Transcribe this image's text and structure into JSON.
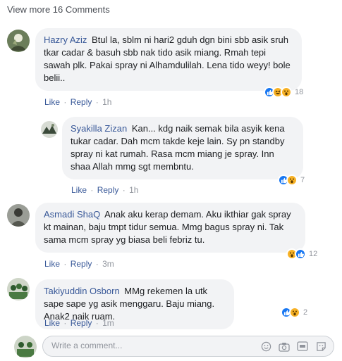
{
  "view_more": "View more 16 Comments",
  "actions": {
    "like": "Like",
    "reply": "Reply",
    "separator": "·"
  },
  "comments": [
    {
      "author": "Hazry Aziz",
      "text": "Btul la, sblm ni hari2 gduh dgn bini sbb asik sruh tkar cadar & basuh sbb nak tido asik miang. Rmah tepi sawah plk. Pakai spray ni Alhamdulilah. Lena tido weyy! bole belii..",
      "time": "1h",
      "reaction_count": "18",
      "reactions": [
        "like-icon",
        "haha-icon",
        "wow-icon"
      ]
    },
    {
      "author": "Syakilla Zizan",
      "text": "Kan... kdg naik semak bila asyik kena tukar cadar. Dah mcm takde keje lain. Sy pn standby spray ni kat rumah. Rasa mcm miang je spray. Inn shaa Allah mmg sgt membntu.",
      "time": "1h",
      "reaction_count": "7",
      "reactions": [
        "like-icon",
        "wow-icon"
      ]
    },
    {
      "author": "Asmadi ShaQ",
      "text": "Anak aku kerap demam. Aku ikthiar gak spray kt mainan, baju tmpt tidur semua. Mmg bagus spray ni. Tak sama mcm spray yg biasa beli febriz tu.",
      "time": "3m",
      "reaction_count": "12",
      "reactions": [
        "wow-icon",
        "like-icon"
      ]
    },
    {
      "author": "Takiyuddin Osborn",
      "text": "MMg rekemen la utk sape sape yg asik menggaru. Baju miang. Anak2 naik ruam.",
      "time": "1m",
      "reaction_count": "2",
      "reactions": [
        "like-icon",
        "wow-icon"
      ]
    }
  ],
  "write_comment": {
    "placeholder": "Write a comment..."
  },
  "composer_icons": [
    "emoji-icon",
    "camera-icon",
    "gif-icon",
    "sticker-icon"
  ],
  "colors": {
    "link": "#385898",
    "bubble": "#f2f3f5",
    "muted": "#90949c",
    "like": "#1877f2",
    "emoji": "#f7b125"
  }
}
